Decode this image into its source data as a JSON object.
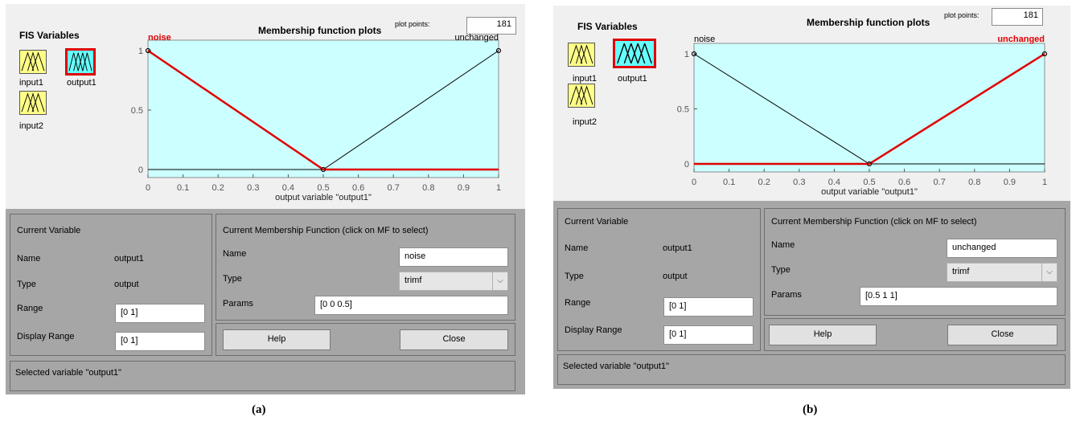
{
  "panels": [
    {
      "caption": "(a)",
      "fis_title": "FIS Variables",
      "variables": [
        "input1",
        "output1",
        "input2"
      ],
      "selected_variable": "output1",
      "plot_title": "Membership function plots",
      "plot_points_label": "plot points:",
      "plot_points_value": "181",
      "mf_labels": [
        "noise",
        "unchanged"
      ],
      "selected_mf": "noise",
      "x_ticks": [
        "0",
        "0.1",
        "0.2",
        "0.3",
        "0.4",
        "0.5",
        "0.6",
        "0.7",
        "0.8",
        "0.9",
        "1"
      ],
      "y_ticks": [
        "0",
        "0.5",
        "1"
      ],
      "x_axis_label": "output variable \"output1\"",
      "current_variable": {
        "title": "Current Variable",
        "name_label": "Name",
        "name_value": "output1",
        "type_label": "Type",
        "type_value": "output",
        "range_label": "Range",
        "range_value": "[0 1]",
        "display_range_label": "Display Range",
        "display_range_value": "[0 1]"
      },
      "current_mf": {
        "title": "Current Membership Function (click on MF to select)",
        "name_label": "Name",
        "name_value": "noise",
        "type_label": "Type",
        "type_value": "trimf",
        "params_label": "Params",
        "params_value": "[0 0 0.5]"
      },
      "help_button": "Help",
      "close_button": "Close",
      "status": "Selected variable \"output1\""
    },
    {
      "caption": "(b)",
      "fis_title": "FIS Variables",
      "variables": [
        "input1",
        "output1",
        "input2"
      ],
      "selected_variable": "output1",
      "plot_title": "Membership function plots",
      "plot_points_label": "plot points:",
      "plot_points_value": "181",
      "mf_labels": [
        "noise",
        "unchanged"
      ],
      "selected_mf": "unchanged",
      "x_ticks": [
        "0",
        "0.1",
        "0.2",
        "0.3",
        "0.4",
        "0.5",
        "0.6",
        "0.7",
        "0.8",
        "0.9",
        "1"
      ],
      "y_ticks": [
        "0",
        "0.5",
        "1"
      ],
      "x_axis_label": "output variable \"output1\"",
      "current_variable": {
        "title": "Current Variable",
        "name_label": "Name",
        "name_value": "output1",
        "type_label": "Type",
        "type_value": "output",
        "range_label": "Range",
        "range_value": "[0 1]",
        "display_range_label": "Display Range",
        "display_range_value": "[0 1]"
      },
      "current_mf": {
        "title": "Current Membership Function (click on MF to select)",
        "name_label": "Name",
        "name_value": "unchanged",
        "type_label": "Type",
        "type_value": "trimf",
        "params_label": "Params",
        "params_value": "[0.5 1 1]"
      },
      "help_button": "Help",
      "close_button": "Close",
      "status": "Selected variable \"output1\""
    }
  ],
  "membership_functions": {
    "noise": [
      0,
      0,
      0.5
    ],
    "unchanged": [
      0.5,
      1,
      1
    ]
  },
  "colors": {
    "plot_bg": "#ccffff",
    "selected": "#e00000",
    "unselected": "#000000"
  }
}
